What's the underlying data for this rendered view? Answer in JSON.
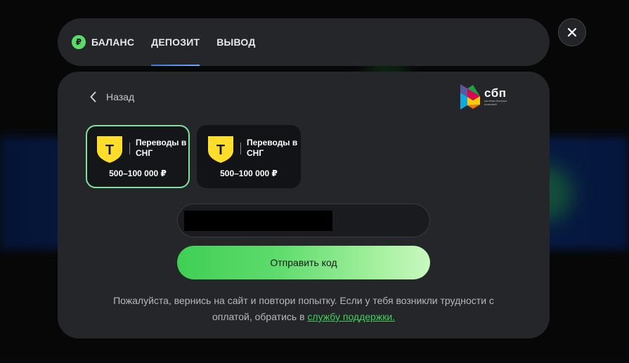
{
  "tabs": [
    {
      "label": "БАЛАНС",
      "icon": "ruble-icon",
      "icon_glyph": "₽"
    },
    {
      "label": "ДЕПОЗИТ",
      "active": true
    },
    {
      "label": "ВЫВОД"
    }
  ],
  "back_label": "Назад",
  "sbp": {
    "title": "сбп",
    "subtitle": "система быстрых платежей"
  },
  "methods": [
    {
      "logo_glyph": "T",
      "name": "Переводы в СНГ",
      "range": "500–100 000 ₽",
      "selected": true
    },
    {
      "logo_glyph": "T",
      "name": "Переводы в СНГ",
      "range": "500–100 000 ₽",
      "selected": false
    }
  ],
  "phone_input": {
    "value": "",
    "placeholder": ""
  },
  "send_button_label": "Отправить код",
  "help": {
    "text": "Пожалуйста, вернись на сайт и повтори попытку. Если у тебя возникли трудности с оплатой, обратись в ",
    "link": "службу поддержки."
  },
  "colors": {
    "accent_green": "#3fd15a",
    "tab_underline": "#3a7bd5",
    "tinkoff_yellow": "#ffdd2d"
  }
}
